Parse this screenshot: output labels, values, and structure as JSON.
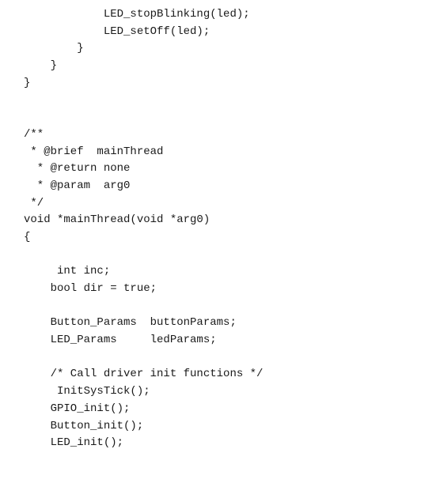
{
  "code": {
    "lines": [
      "            LED_stopBlinking(led);",
      "            LED_setOff(led);",
      "        }",
      "    }",
      "}",
      "",
      "",
      "/**",
      " * @brief  mainThread",
      "  * @return none",
      "  * @param  arg0",
      " */",
      "void *mainThread(void *arg0)",
      "{",
      "",
      "     int inc;",
      "    bool dir = true;",
      "",
      "    Button_Params  buttonParams;",
      "    LED_Params     ledParams;",
      "",
      "    /* Call driver init functions */",
      "     InitSysTick();",
      "    GPIO_init();",
      "    Button_init();",
      "    LED_init();"
    ]
  }
}
